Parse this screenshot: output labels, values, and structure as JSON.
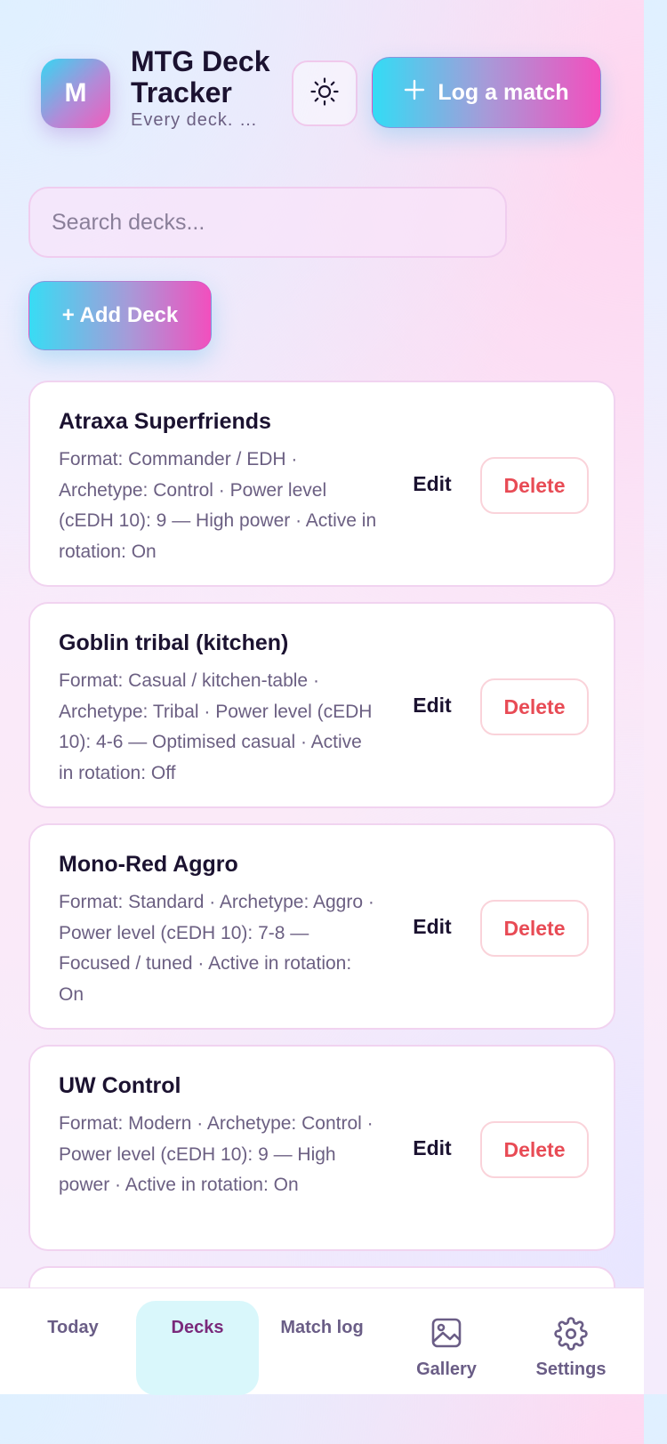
{
  "header": {
    "logo_letter": "M",
    "title": "MTG Deck Tracker",
    "subtitle": "Every deck. …",
    "log_match_label": "Log a match",
    "theme_icon": "sun-icon"
  },
  "search": {
    "placeholder": "Search decks...",
    "value": ""
  },
  "add_deck_label": "+ Add Deck",
  "decks": [
    {
      "name": "Atraxa Superfriends",
      "meta": "Format: Commander / EDH · Archetype: Control · Power level (cEDH 10): 9 — High power · Active in rotation: On",
      "edit_label": "Edit",
      "delete_label": "Delete"
    },
    {
      "name": "Goblin tribal (kitchen)",
      "meta": "Format: Casual / kitchen-table · Archetype: Tribal · Power level (cEDH 10): 4-6 — Optimised casual · Active in rotation: Off",
      "edit_label": "Edit",
      "delete_label": "Delete"
    },
    {
      "name": "Mono-Red Aggro",
      "meta": "Format: Standard · Archetype: Aggro · Power level (cEDH 10): 7-8 — Focused / tuned · Active in rotation: On",
      "edit_label": "Edit",
      "delete_label": "Delete"
    },
    {
      "name": "UW Control",
      "meta": "Format: Modern · Archetype: Control · Power level (cEDH 10): 9 — High power · Active in rotation: On",
      "edit_label": "Edit",
      "delete_label": "Delete"
    }
  ],
  "nav": {
    "today": "Today",
    "decks": "Decks",
    "match_log": "Match log",
    "gallery": "Gallery",
    "settings": "Settings",
    "active": "Decks"
  },
  "colors": {
    "accent_cyan": "#36d6f2",
    "accent_pink": "#f05cbc",
    "delete_red": "#e84b55",
    "active_nav_bg": "#d9f7fb"
  }
}
